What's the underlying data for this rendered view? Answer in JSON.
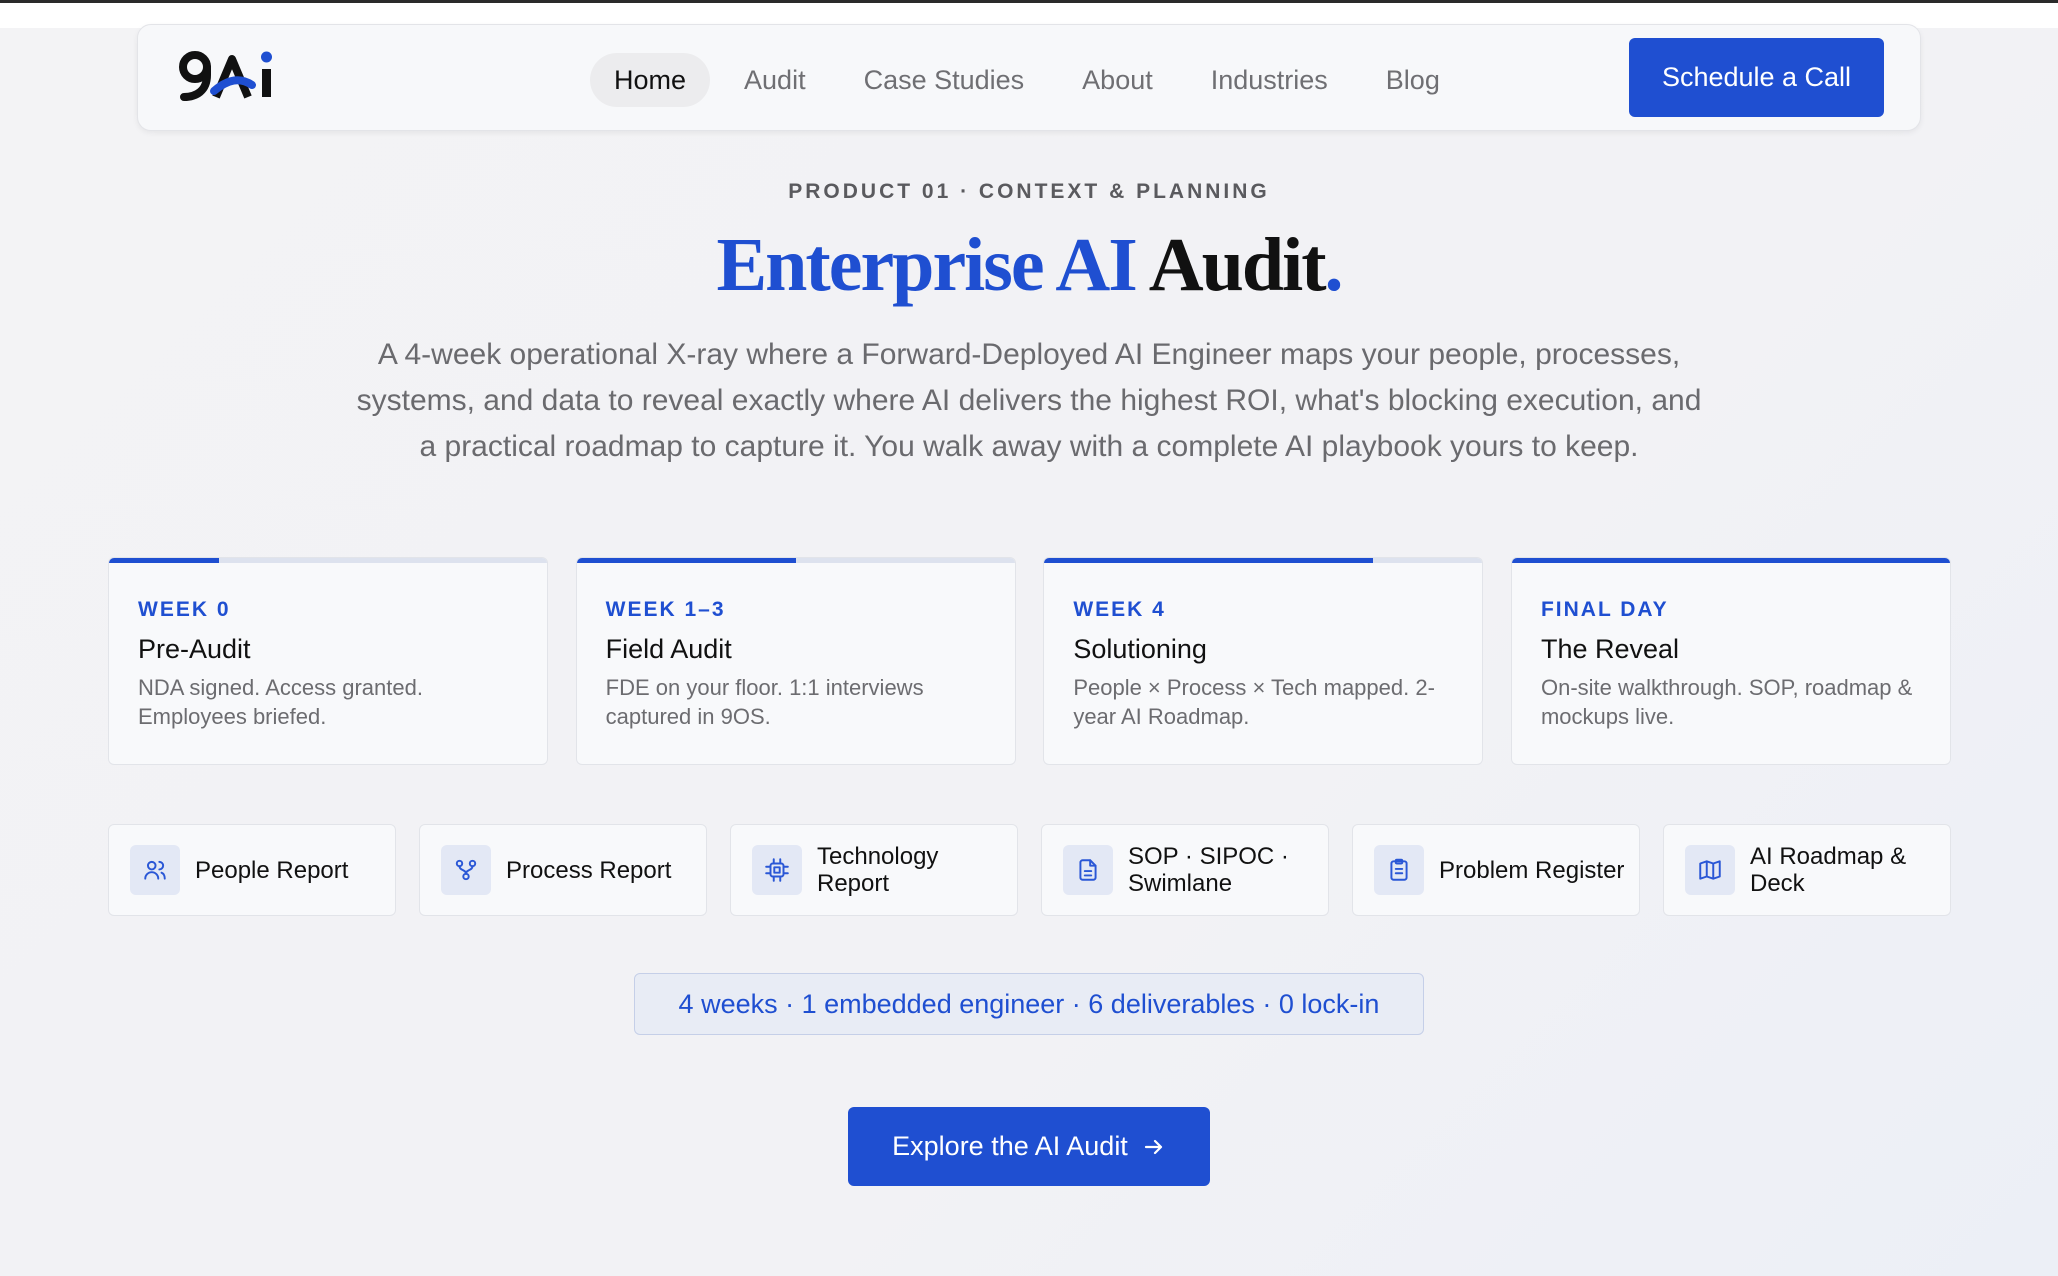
{
  "brand": {
    "logo_text": "9Ai",
    "accent": "#1f4fd1"
  },
  "nav": {
    "items": [
      {
        "label": "Home",
        "active": true
      },
      {
        "label": "Audit"
      },
      {
        "label": "Case Studies"
      },
      {
        "label": "About"
      },
      {
        "label": "Industries"
      },
      {
        "label": "Blog"
      }
    ],
    "cta_label": "Schedule a Call"
  },
  "hero": {
    "eyebrow": "PRODUCT 01 · CONTEXT & PLANNING",
    "title_blue": "Enterprise AI",
    "title_dark": "Audit",
    "title_dot": ".",
    "lead": "A 4-week operational X-ray where a Forward-Deployed AI Engineer maps your people, processes, systems, and data to reveal exactly where AI delivers the highest ROI, what's blocking execution, and a practical roadmap to capture it. You walk away with a complete AI playbook yours to keep."
  },
  "timeline": [
    {
      "tag": "WEEK 0",
      "title": "Pre-Audit",
      "desc": "NDA signed. Access granted. Employees briefed.",
      "progress": 0.25
    },
    {
      "tag": "WEEK 1–3",
      "title": "Field Audit",
      "desc": "FDE on your floor. 1:1 interviews captured in 9OS.",
      "progress": 0.5
    },
    {
      "tag": "WEEK 4",
      "title": "Solutioning",
      "desc": "People × Process × Tech mapped. 2-year AI Roadmap.",
      "progress": 0.75
    },
    {
      "tag": "FINAL DAY",
      "title": "The Reveal",
      "desc": "On-site walkthrough. SOP, roadmap & mockups live.",
      "progress": 1.0
    }
  ],
  "deliverables": [
    {
      "label": "People Report",
      "icon": "users-icon"
    },
    {
      "label": "Process Report",
      "icon": "workflow-icon"
    },
    {
      "label": "Technology Report",
      "icon": "chip-icon"
    },
    {
      "label": "SOP · SIPOC · Swimlane",
      "icon": "document-icon"
    },
    {
      "label": "Problem Register",
      "icon": "clipboard-icon"
    },
    {
      "label": "AI Roadmap & Deck",
      "icon": "map-icon"
    }
  ],
  "stats_text": "4 weeks · 1 embedded engineer · 6 deliverables · 0 lock-in",
  "main_cta_label": "Explore the AI Audit"
}
